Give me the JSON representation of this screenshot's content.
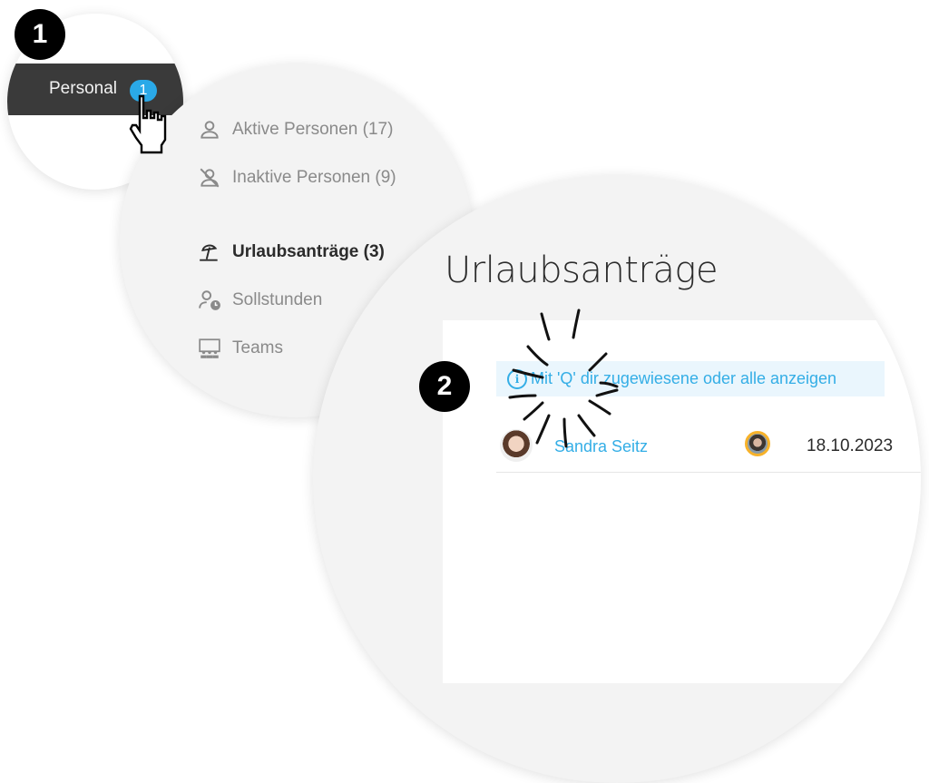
{
  "steps": [
    "1",
    "2"
  ],
  "nav": {
    "label": "Personal",
    "badge": "1"
  },
  "menu": {
    "items": [
      {
        "label": "Aktive Personen (17)",
        "icon": "person-icon",
        "active": false
      },
      {
        "label": "Inaktive Personen (9)",
        "icon": "person-off-icon",
        "active": false
      },
      {
        "label": "Urlaubsanträge (3)",
        "icon": "beach-umbrella-icon",
        "active": true
      },
      {
        "label": "Sollstunden",
        "icon": "person-clock-icon",
        "active": false
      },
      {
        "label": "Teams",
        "icon": "teams-icon",
        "active": false
      }
    ]
  },
  "main": {
    "title": "Urlaubsanträge",
    "info": {
      "icon": "info-icon",
      "text": "Mit 'Q' dir zugewiesene oder alle anzeigen"
    },
    "rows": [
      {
        "name": "Sandra Seitz",
        "date": "18.10.2023"
      }
    ]
  },
  "colors": {
    "accent": "#34aee6",
    "badge": "#2aa9e8",
    "approver_ring": "#f7b22a",
    "nav_band": "#3a3a3a"
  }
}
